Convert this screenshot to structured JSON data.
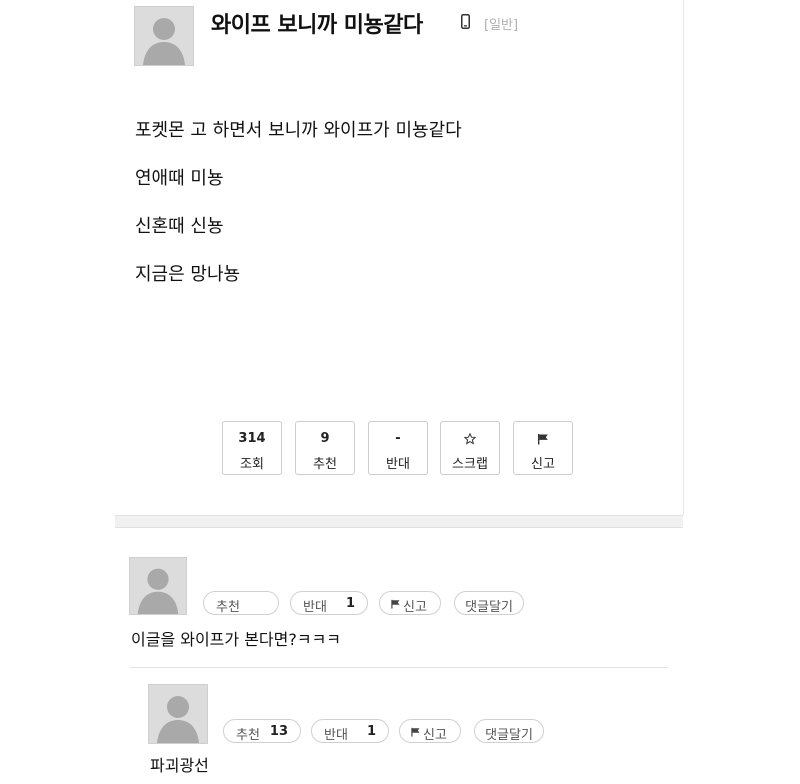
{
  "post": {
    "title": "와이프 보니까 미뇽같다",
    "category": "[일반]",
    "body_lines": [
      "포켓몬 고 하면서 보니까 와이프가 미뇽같다",
      "연애때 미뇽",
      "신혼때 신뇽",
      "지금은 망나뇽"
    ]
  },
  "stats": {
    "views_value": "314",
    "views_label": "조회",
    "recommend_value": "9",
    "recommend_label": "추천",
    "oppose_value": "-",
    "oppose_label": "반대",
    "scrap_label": "스크랩",
    "report_label": "신고"
  },
  "comments": [
    {
      "text": "이글을 와이프가 본다면?ㅋㅋㅋ",
      "recommend_label": "추천",
      "recommend_count": "",
      "oppose_label": "반대",
      "oppose_count": "1",
      "report_label": "신고",
      "reply_label": "댓글달기"
    },
    {
      "text": "파괴광선",
      "recommend_label": "추천",
      "recommend_count": "13",
      "oppose_label": "반대",
      "oppose_count": "1",
      "report_label": "신고",
      "reply_label": "댓글달기"
    }
  ],
  "icons": {
    "avatar": "default-avatar-icon",
    "phone": "mobile-phone-icon",
    "star": "star-outline-icon",
    "flag": "flag-icon"
  },
  "colors": {
    "border": "#cccccc",
    "muted": "#b0b0b0",
    "text": "#111111"
  }
}
